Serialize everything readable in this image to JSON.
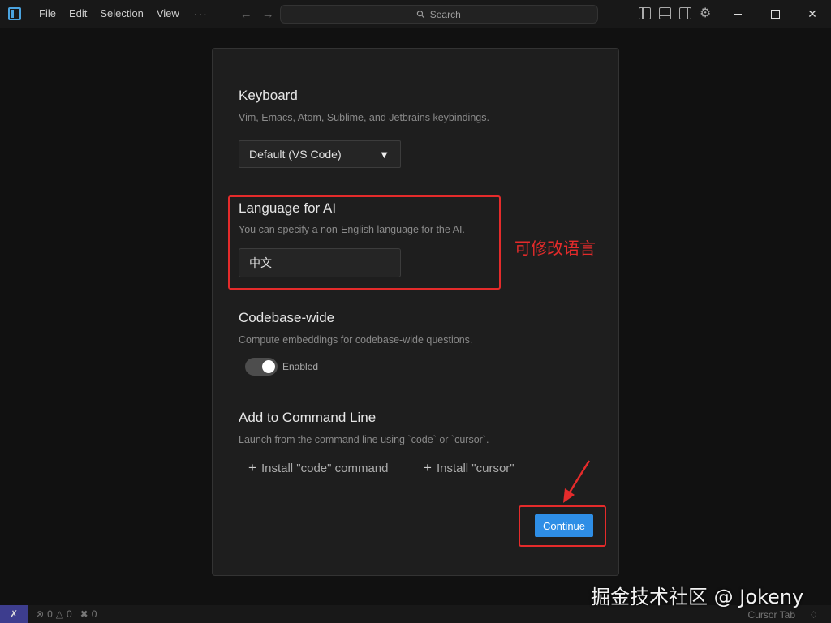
{
  "titlebar": {
    "menu": [
      "File",
      "Edit",
      "Selection",
      "View"
    ],
    "more": "···",
    "search_placeholder": "Search"
  },
  "dialog": {
    "keyboard": {
      "title": "Keyboard",
      "desc": "Vim, Emacs, Atom, Sublime, and Jetbrains keybindings.",
      "selected": "Default (VS Code)"
    },
    "language": {
      "title": "Language for AI",
      "desc": "You can specify a non-English language for the AI.",
      "value": "中文"
    },
    "codebase": {
      "title": "Codebase-wide",
      "desc": "Compute embeddings for codebase-wide questions.",
      "toggle_label": "Enabled",
      "enabled": true
    },
    "command_line": {
      "title": "Add to Command Line",
      "desc": "Launch from the command line using `code` or `cursor`.",
      "install_code": "Install \"code\" command",
      "install_cursor": "Install \"cursor\""
    },
    "continue_label": "Continue"
  },
  "annotation": {
    "note": "可修改语言",
    "color": "#e52b2b"
  },
  "statusbar": {
    "errors": "0",
    "warnings": "0",
    "ports": "0",
    "right_label": "Cursor Tab"
  },
  "watermark": "掘金技术社区 @ Jokeny",
  "colors": {
    "accent": "#2e8ee6",
    "background": "#111111",
    "dialog": "#1e1e1e"
  },
  "icons": [
    "app-icon",
    "arrow-left-icon",
    "arrow-right-icon",
    "search-icon",
    "toggle-sidebar-icon",
    "toggle-panel-icon",
    "toggle-secondary-sidebar-icon",
    "gear-icon",
    "minimize-icon",
    "maximize-icon",
    "close-icon",
    "remote-icon",
    "error-icon",
    "warning-icon",
    "ports-icon",
    "bell-icon"
  ]
}
